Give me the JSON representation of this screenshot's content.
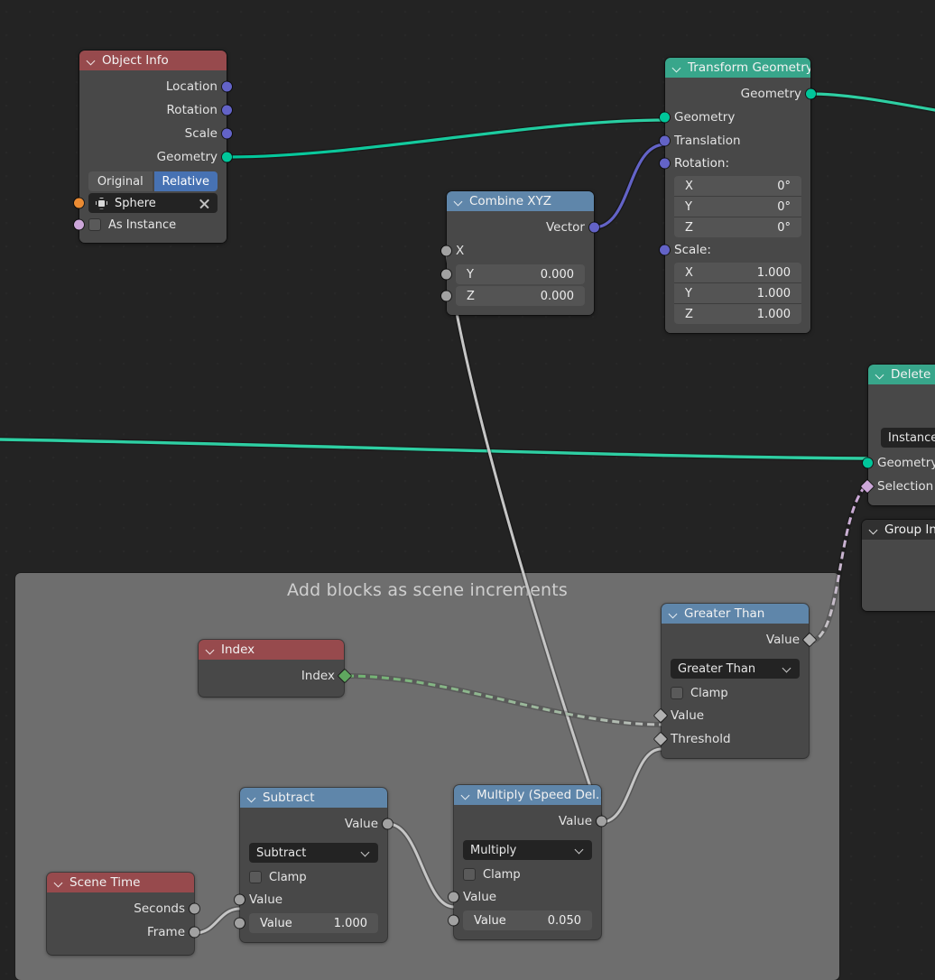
{
  "editor": {
    "background_color": "#232323",
    "kind": "geometry-node-editor"
  },
  "frame": {
    "label": "Add blocks as scene increments",
    "color": "#6e6e6e"
  },
  "nodes": {
    "object_info": {
      "title": "Object Info",
      "header_color": "#974a4d",
      "outputs": [
        {
          "label": "Location",
          "socket": "vector-socket"
        },
        {
          "label": "Rotation",
          "socket": "vector-socket"
        },
        {
          "label": "Scale",
          "socket": "vector-socket"
        },
        {
          "label": "Geometry",
          "socket": "geometry-socket"
        }
      ],
      "transform_space": {
        "options": [
          "Original",
          "Relative"
        ],
        "selected": "Relative"
      },
      "object_field": {
        "value": "Sphere",
        "clear_label": "×"
      },
      "as_instance": {
        "label": "As Instance",
        "checked": false
      }
    },
    "transform_geometry": {
      "title": "Transform Geometry",
      "header_color": "#38a68b",
      "output": {
        "label": "Geometry",
        "socket": "geometry-socket"
      },
      "inputs": [
        {
          "label": "Geometry",
          "socket": "geometry-socket"
        },
        {
          "label": "Translation",
          "socket": "vector-socket"
        }
      ],
      "rotation": {
        "label": "Rotation:",
        "x": "0°",
        "y": "0°",
        "z": "0°",
        "keys": [
          "X",
          "Y",
          "Z"
        ]
      },
      "scale": {
        "label": "Scale:",
        "x": "1.000",
        "y": "1.000",
        "z": "1.000",
        "keys": [
          "X",
          "Y",
          "Z"
        ]
      }
    },
    "combine_xyz": {
      "title": "Combine XYZ",
      "header_color": "#5f86aa",
      "output": {
        "label": "Vector",
        "socket": "vector-socket"
      },
      "input_x": {
        "label": "X"
      },
      "input_y": {
        "label": "Y",
        "value": "0.000"
      },
      "input_z": {
        "label": "Z",
        "value": "0.000"
      }
    },
    "delete_geometry": {
      "title": "Delete ",
      "header_color": "#38a68b",
      "mode": "Instance",
      "inputs": [
        {
          "label": "Geometry",
          "socket": "geometry-socket"
        },
        {
          "label": "Selection",
          "socket": "boolean-socket"
        }
      ]
    },
    "group_input": {
      "title": "Group Inp",
      "header_color": "#303030"
    },
    "index": {
      "title": "Index",
      "header_color": "#974a4d",
      "output": {
        "label": "Index",
        "socket": "integer-field-socket"
      }
    },
    "greater_than": {
      "title": "Greater Than",
      "header_color": "#5f86aa",
      "output": {
        "label": "Value",
        "socket": "value-field-socket"
      },
      "operation": "Greater Than",
      "clamp": {
        "label": "Clamp",
        "checked": false
      },
      "inputs": [
        {
          "label": "Value",
          "socket": "value-field-socket"
        },
        {
          "label": "Threshold",
          "socket": "value-field-socket"
        }
      ]
    },
    "subtract": {
      "title": "Subtract",
      "header_color": "#5f86aa",
      "output": {
        "label": "Value",
        "socket": "value-socket"
      },
      "operation": "Subtract",
      "clamp": {
        "label": "Clamp",
        "checked": false
      },
      "input_a": {
        "label": "Value"
      },
      "input_b": {
        "label": "Value",
        "value": "1.000"
      }
    },
    "multiply": {
      "title": "Multiply (Speed Del…",
      "header_color": "#5f86aa",
      "output": {
        "label": "Value",
        "socket": "value-socket"
      },
      "operation": "Multiply",
      "clamp": {
        "label": "Clamp",
        "checked": false
      },
      "input_a": {
        "label": "Value"
      },
      "input_b": {
        "label": "Value",
        "value": "0.050"
      }
    },
    "scene_time": {
      "title": "Scene Time",
      "header_color": "#974a4d",
      "outputs": [
        {
          "label": "Seconds",
          "socket": "value-socket"
        },
        {
          "label": "Frame",
          "socket": "value-socket"
        }
      ]
    }
  },
  "socket_colors": {
    "geometry": "#00c69a",
    "vector": "#6363c7",
    "value": "#a1a1a1",
    "boolean": "#cca6d9",
    "integer": "#5fa75f",
    "object": "#eb8b33"
  },
  "links": [
    {
      "from": "object_info.geometry",
      "to": "transform_geometry.geometry",
      "color": "#00c69a",
      "style": "solid"
    },
    {
      "from": "combine_xyz.vector",
      "to": "transform_geometry.translation",
      "color": "#6363c7",
      "style": "solid"
    },
    {
      "from": "transform_geometry.geometry_out",
      "to": "offscreen-right",
      "color": "#00c69a",
      "style": "solid"
    },
    {
      "from": "offscreen-left",
      "to": "delete_geometry.geometry",
      "color": "#00c69a",
      "style": "solid"
    },
    {
      "from": "greater_than.value",
      "to": "delete_geometry.selection",
      "color": "#cca6d9",
      "style": "dashed"
    },
    {
      "from": "index.index",
      "to": "greater_than.value_in",
      "color": "#5fa75f",
      "style": "dashed"
    },
    {
      "from": "multiply.value",
      "to": "combine_xyz.x",
      "color": "#a1a1a1",
      "style": "solid"
    },
    {
      "from": "multiply.value",
      "to": "greater_than.threshold",
      "color": "#a1a1a1",
      "style": "solid"
    },
    {
      "from": "subtract.value",
      "to": "multiply.value_in",
      "color": "#a1a1a1",
      "style": "solid"
    },
    {
      "from": "scene_time.frame",
      "to": "subtract.value_in",
      "color": "#a1a1a1",
      "style": "solid"
    }
  ]
}
